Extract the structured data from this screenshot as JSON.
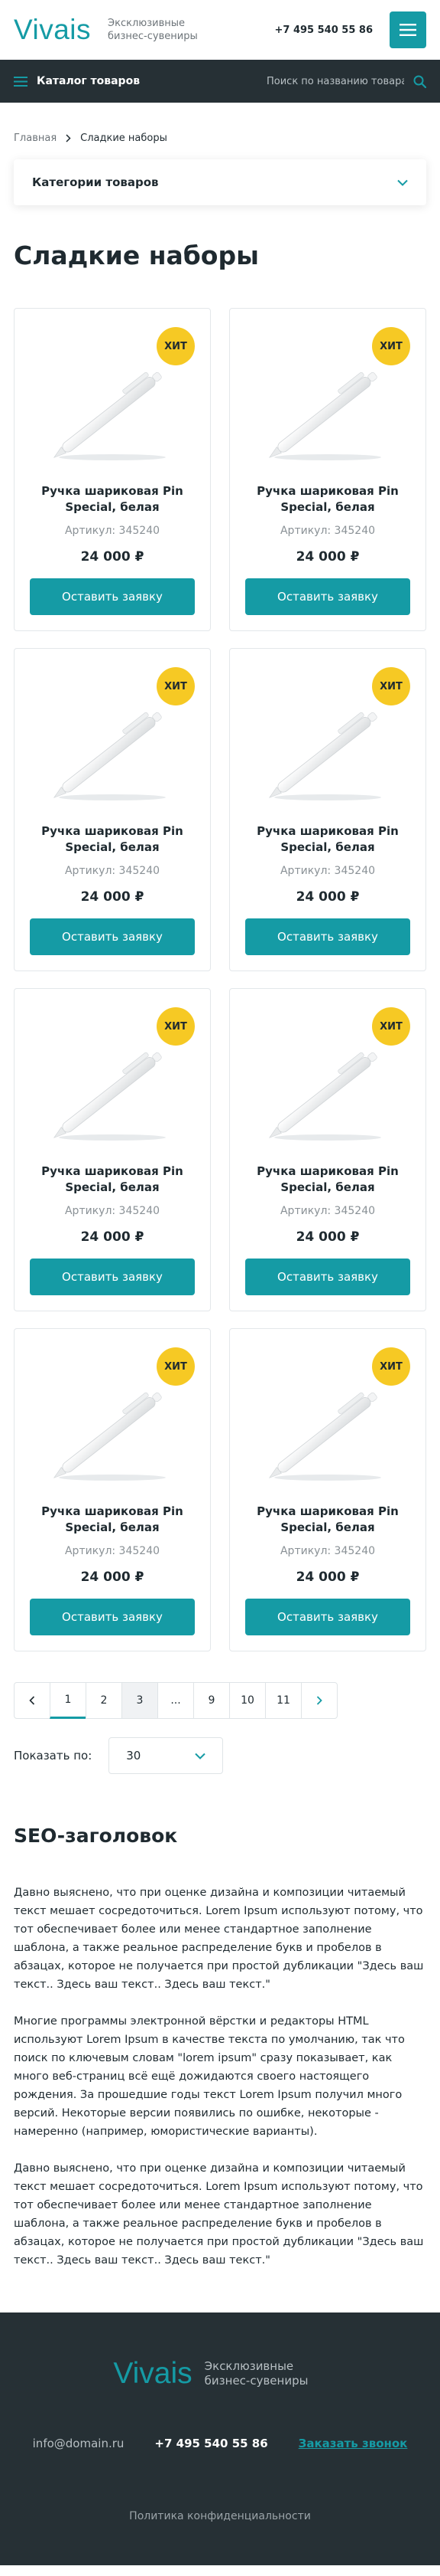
{
  "header": {
    "logo": "Vivais",
    "tagline": "Эксклюзивные бизнес-сувениры",
    "phone": "+7 495 540 55 86"
  },
  "navbar": {
    "catalog_label": "Каталог товаров",
    "search_placeholder": "Поиск по названию товара"
  },
  "breadcrumb": {
    "home": "Главная",
    "current": "Сладкие наборы"
  },
  "categories": {
    "label": "Категории товаров"
  },
  "page_title": "Сладкие наборы",
  "products": [
    {
      "badge": "ХИТ",
      "name": "Ручка шариковая Pin Special, белая",
      "article": "Артикул: 345240",
      "price": "24 000 ₽",
      "button": "Оставить заявку"
    },
    {
      "badge": "ХИТ",
      "name": "Ручка шариковая Pin Special, белая",
      "article": "Артикул: 345240",
      "price": "24 000 ₽",
      "button": "Оставить заявку"
    },
    {
      "badge": "ХИТ",
      "name": "Ручка шариковая Pin Special, белая",
      "article": "Артикул: 345240",
      "price": "24 000 ₽",
      "button": "Оставить заявку"
    },
    {
      "badge": "ХИТ",
      "name": "Ручка шариковая Pin Special, белая",
      "article": "Артикул: 345240",
      "price": "24 000 ₽",
      "button": "Оставить заявку"
    },
    {
      "badge": "ХИТ",
      "name": "Ручка шариковая Pin Special, белая",
      "article": "Артикул: 345240",
      "price": "24 000 ₽",
      "button": "Оставить заявку"
    },
    {
      "badge": "ХИТ",
      "name": "Ручка шариковая Pin Special, белая",
      "article": "Артикул: 345240",
      "price": "24 000 ₽",
      "button": "Оставить заявку"
    },
    {
      "badge": "ХИТ",
      "name": "Ручка шариковая Pin Special, белая",
      "article": "Артикул: 345240",
      "price": "24 000 ₽",
      "button": "Оставить заявку"
    },
    {
      "badge": "ХИТ",
      "name": "Ручка шариковая Pin Special, белая",
      "article": "Артикул: 345240",
      "price": "24 000 ₽",
      "button": "Оставить заявку"
    }
  ],
  "pagination": {
    "pages": [
      "1",
      "2",
      "3",
      "...",
      "9",
      "10",
      "11"
    ],
    "active_page": "1",
    "current_page": "3"
  },
  "per_page": {
    "label": "Показать по:",
    "value": "30"
  },
  "seo": {
    "title": "SEO-заголовок",
    "paragraphs": [
      "Давно выяснено, что при оценке дизайна и композиции читаемый текст мешает сосредоточиться. Lorem Ipsum используют потому, что тот обеспечивает более или менее стандартное заполнение шаблона, а также реальное распределение букв и пробелов в абзацах, которое не получается при простой дубликации \"Здесь ваш текст.. Здесь ваш текст.. Здесь ваш текст.\"",
      "Многие программы электронной вёрстки и редакторы HTML используют Lorem Ipsum в качестве текста по умолчанию, так что поиск по ключевым словам \"lorem ipsum\" сразу показывает, как много веб-страниц всё ещё дожидаются своего настоящего рождения. За прошедшие годы текст Lorem Ipsum получил много версий. Некоторые версии появились по ошибке, некоторые - намеренно (например, юмористические варианты).",
      "Давно выяснено, что при оценке дизайна и композиции читаемый текст мешает сосредоточиться. Lorem Ipsum используют потому, что тот обеспечивает более или менее стандартное заполнение шаблона, а также реальное распределение букв и пробелов в абзацах, которое не получается при простой дубликации \"Здесь ваш текст.. Здесь ваш текст.. Здесь ваш текст.\""
    ]
  },
  "footer": {
    "logo": "Vivais",
    "tagline": "Эксклюзивные бизнес-сувениры",
    "email": "info@domain.ru",
    "phone": "+7 495 540 55 86",
    "callback": "Заказать звонок",
    "policy": "Политика конфиденциальности"
  },
  "colors": {
    "accent": "#159ba5",
    "dark": "#263035",
    "badge": "#f6c924"
  }
}
